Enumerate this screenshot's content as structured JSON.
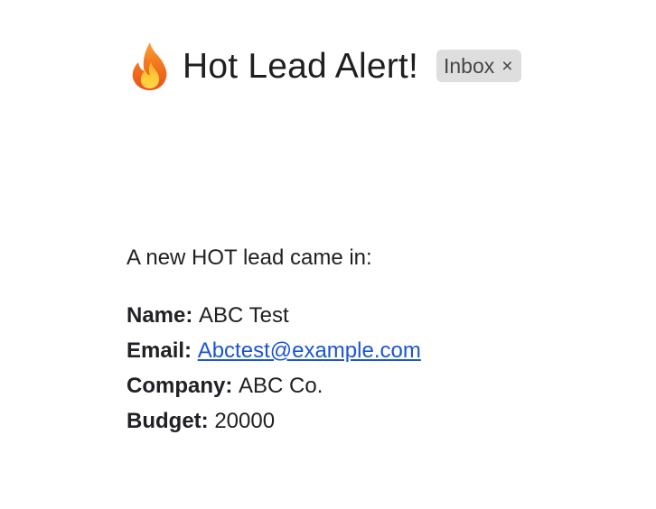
{
  "header": {
    "subject": "Hot Lead Alert!",
    "icon": "fire-icon",
    "label_chip": {
      "text": "Inbox",
      "close_glyph": "×"
    }
  },
  "body": {
    "intro": "A new HOT lead came in:",
    "fields": [
      {
        "label": "Name:",
        "value": "ABC Test"
      },
      {
        "label": "Email:",
        "value": "Abctest@example.com"
      },
      {
        "label": "Company:",
        "value": "ABC Co."
      },
      {
        "label": "Budget:",
        "value": "20000"
      }
    ]
  },
  "colors": {
    "link": "#1a55d6",
    "chip_bg": "#dddedd",
    "text": "#202124"
  }
}
